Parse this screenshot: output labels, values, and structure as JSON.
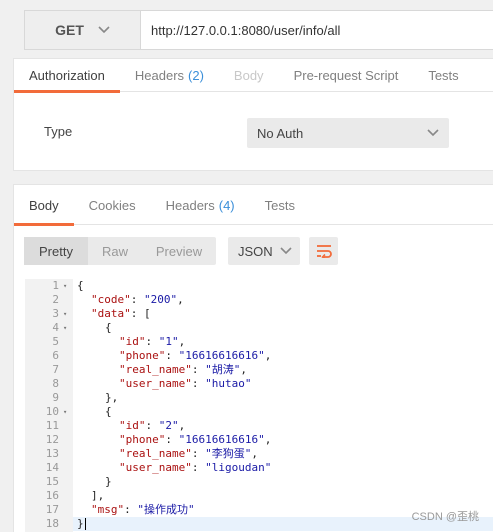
{
  "request": {
    "method": "GET",
    "url": "http://127.0.0.1:8080/user/info/all",
    "tabs": [
      {
        "label": "Authorization",
        "count": ""
      },
      {
        "label": "Headers",
        "count": "(2)"
      },
      {
        "label": "Body",
        "count": ""
      },
      {
        "label": "Pre-request Script",
        "count": ""
      },
      {
        "label": "Tests",
        "count": ""
      }
    ],
    "auth": {
      "type_label": "Type",
      "type_value": "No Auth"
    }
  },
  "response": {
    "tabs": [
      {
        "label": "Body",
        "count": ""
      },
      {
        "label": "Cookies",
        "count": ""
      },
      {
        "label": "Headers",
        "count": "(4)"
      },
      {
        "label": "Tests",
        "count": ""
      }
    ],
    "view_modes": [
      "Pretty",
      "Raw",
      "Preview"
    ],
    "format": "JSON",
    "line_numbers": [
      "1",
      "2",
      "3",
      "4",
      "5",
      "6",
      "7",
      "8",
      "9",
      "10",
      "11",
      "12",
      "13",
      "14",
      "15",
      "16",
      "17",
      "18"
    ],
    "json_body": {
      "code": "200",
      "data": [
        {
          "id": "1",
          "phone": "16616616616",
          "real_name": "胡涛",
          "user_name": "hutao"
        },
        {
          "id": "2",
          "phone": "16616616616",
          "real_name": "李狗蛋",
          "user_name": "ligoudan"
        }
      ],
      "msg": "操作成功"
    }
  },
  "watermark": "CSDN @歪桃",
  "colors": {
    "accent": "#f26b3a",
    "count_blue": "#3b8fd9",
    "json_key": "#a11",
    "json_string": "#1a1aa6"
  },
  "icons": [
    "chevron-down-icon",
    "wrap-lines-icon",
    "fold-arrow-icon"
  ]
}
